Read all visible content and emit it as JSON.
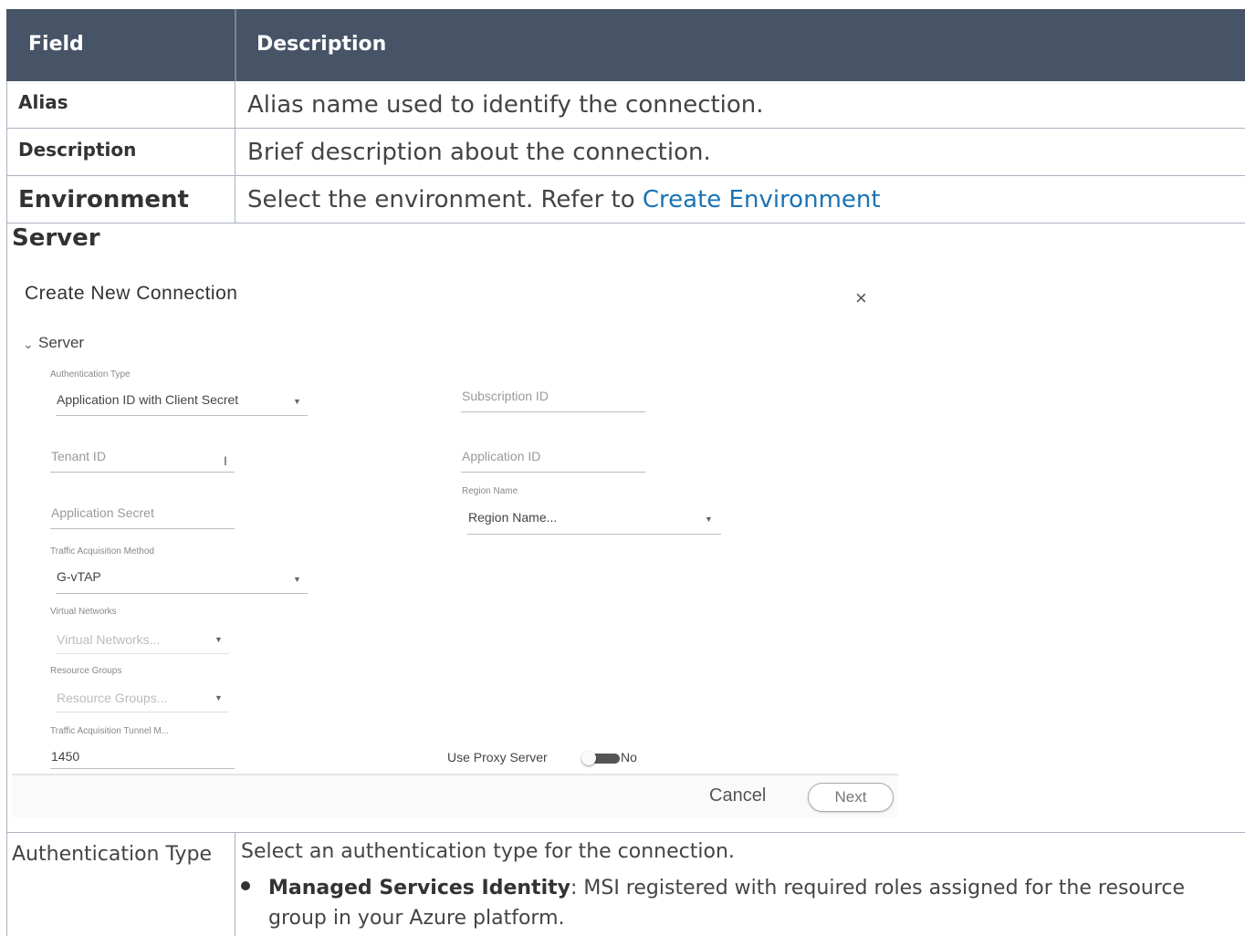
{
  "table": {
    "header": {
      "field": "Field",
      "description": "Description"
    },
    "rows": [
      {
        "field": "Alias",
        "description": "Alias name used to identify the connection."
      },
      {
        "field": "Description",
        "description": "Brief description about the connection."
      },
      {
        "field": "Environment",
        "description_prefix": "Select the environment. Refer to ",
        "description_link": "Create Environment"
      }
    ],
    "server_row_title": "Server"
  },
  "dialog": {
    "title": "Create New Connection",
    "close_icon": "×",
    "section_chevron": "⌄",
    "section_label": "Server",
    "auth_type": {
      "label": "Authentication Type",
      "value": "Application ID with Client Secret"
    },
    "subscription_id": {
      "placeholder": "Subscription ID"
    },
    "tenant_id": {
      "placeholder": "Tenant ID"
    },
    "application_id": {
      "placeholder": "Application ID"
    },
    "application_secret": {
      "placeholder": "Application Secret"
    },
    "region_name": {
      "label": "Region Name",
      "value": "Region Name..."
    },
    "traffic_method": {
      "label": "Traffic Acquisition Method",
      "value": "G-vTAP"
    },
    "virtual_networks": {
      "label": "Virtual Networks",
      "value": "Virtual Networks..."
    },
    "resource_groups": {
      "label": "Resource Groups",
      "value": "Resource Groups..."
    },
    "tunnel_mtu": {
      "label": "Traffic Acquisition Tunnel M...",
      "value": "1450"
    },
    "use_proxy": {
      "label": "Use Proxy Server",
      "state": "No"
    },
    "cancel_label": "Cancel",
    "next_label": "Next"
  },
  "auth_row": {
    "field": "Authentication Type",
    "description": "Select an authentication type for the connection.",
    "bullet_bold": "Managed Services Identity",
    "bullet_text": ": MSI registered with required roles assigned for the resource group in your Azure platform."
  }
}
